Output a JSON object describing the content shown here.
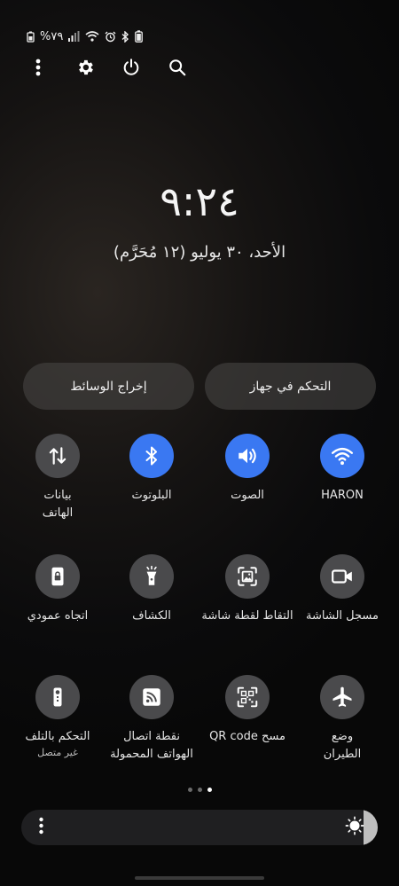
{
  "status_bar": {
    "battery_text": "%٧٩"
  },
  "clock": {
    "time": "٩:٢٤",
    "date": "الأحد، ٣٠ يوليو (١٢ مُحَرَّم)"
  },
  "top_actions": [
    {
      "icon": "more-vert-icon"
    },
    {
      "icon": "gear-icon"
    },
    {
      "icon": "power-icon"
    },
    {
      "icon": "search-icon"
    }
  ],
  "pills": {
    "media_output": "إخراج الوسائط",
    "device_control": "التحكم في جهاز"
  },
  "tiles": [
    {
      "id": "mobile-data",
      "label": "بيانات الهاتف",
      "lines": [
        "بيانات",
        "الهاتف"
      ],
      "sub": "",
      "icon": "data-arrows-icon",
      "active": false
    },
    {
      "id": "bluetooth",
      "lines": [
        "البلوتوث"
      ],
      "sub": "",
      "icon": "bluetooth-icon",
      "active": true
    },
    {
      "id": "sound",
      "lines": [
        "الصوت"
      ],
      "sub": "",
      "icon": "volume-icon",
      "active": true
    },
    {
      "id": "wifi",
      "lines": [
        "HARON"
      ],
      "sub": "",
      "icon": "wifi-icon",
      "active": true
    },
    {
      "id": "portrait",
      "lines": [
        "اتجاه عمودي"
      ],
      "sub": "",
      "icon": "lock-rotation-icon",
      "active": false
    },
    {
      "id": "flashlight",
      "lines": [
        "الكشاف"
      ],
      "sub": "",
      "icon": "flashlight-icon",
      "active": false
    },
    {
      "id": "screenshot",
      "lines": [
        "التقاط لقطة شاشة"
      ],
      "sub": "",
      "icon": "screenshot-icon",
      "active": false
    },
    {
      "id": "screen-recorder",
      "lines": [
        "مسجل الشاشة"
      ],
      "sub": "",
      "icon": "video-camera-icon",
      "active": false
    },
    {
      "id": "remote-control",
      "lines": [
        "التحكم بالتلف"
      ],
      "sub": "غير متصل",
      "icon": "remote-icon",
      "active": false
    },
    {
      "id": "hotspot",
      "lines": [
        "نقطة اتصال",
        "الهواتف المحمولة"
      ],
      "sub": "",
      "icon": "hotspot-icon",
      "active": false
    },
    {
      "id": "qr-scan",
      "lines": [
        "مسح QR code"
      ],
      "sub": "",
      "icon": "qr-code-icon",
      "active": false
    },
    {
      "id": "airplane",
      "lines": [
        "وضع",
        "الطيران"
      ],
      "sub": "",
      "icon": "airplane-icon",
      "active": false
    }
  ],
  "pager": {
    "total": 3,
    "active": 3
  },
  "brightness": {
    "level": 0.04
  },
  "colors": {
    "accent": "#3a78f2",
    "tile_off": "#4a4a4c"
  }
}
